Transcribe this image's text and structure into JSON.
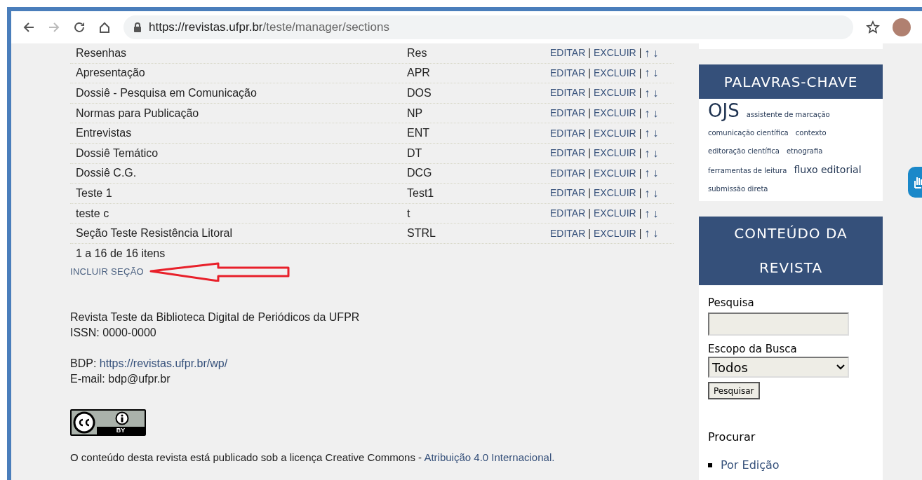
{
  "browser": {
    "url_host": "https://revistas.ufpr.br",
    "url_path": "/teste/manager/sections"
  },
  "table": {
    "rows": [
      {
        "title": "Resenhas",
        "abbrev": "Res",
        "actions": [
          {
            "kind": "link",
            "label": "EDITAR"
          },
          {
            "kind": "separator",
            "label": "|"
          },
          {
            "kind": "link",
            "label": "EXCLUIR"
          },
          {
            "kind": "separator",
            "label": "|"
          },
          {
            "kind": "arrow",
            "label": "↑"
          },
          {
            "kind": "arrow",
            "label": "↓"
          }
        ]
      },
      {
        "title": "Apresentação",
        "abbrev": "APR",
        "actions": [
          {
            "kind": "link",
            "label": "EDITAR"
          },
          {
            "kind": "separator",
            "label": "|"
          },
          {
            "kind": "link",
            "label": "EXCLUIR"
          },
          {
            "kind": "separator",
            "label": "|"
          },
          {
            "kind": "arrow",
            "label": "↑"
          },
          {
            "kind": "arrow",
            "label": "↓"
          }
        ]
      },
      {
        "title": "Dossiê - Pesquisa em Comunicação",
        "abbrev": "DOS",
        "actions": [
          {
            "kind": "link",
            "label": "EDITAR"
          },
          {
            "kind": "separator",
            "label": "|"
          },
          {
            "kind": "link",
            "label": "EXCLUIR"
          },
          {
            "kind": "separator",
            "label": "|"
          },
          {
            "kind": "arrow",
            "label": "↑"
          },
          {
            "kind": "arrow",
            "label": "↓"
          }
        ]
      },
      {
        "title": "Normas para Publicação",
        "abbrev": "NP",
        "actions": [
          {
            "kind": "link",
            "label": "EDITAR"
          },
          {
            "kind": "separator",
            "label": "|"
          },
          {
            "kind": "link",
            "label": "EXCLUIR"
          },
          {
            "kind": "separator",
            "label": "|"
          },
          {
            "kind": "arrow",
            "label": "↑"
          },
          {
            "kind": "arrow",
            "label": "↓"
          }
        ]
      },
      {
        "title": "Entrevistas",
        "abbrev": "ENT",
        "actions": [
          {
            "kind": "link",
            "label": "EDITAR"
          },
          {
            "kind": "separator",
            "label": "|"
          },
          {
            "kind": "link",
            "label": "EXCLUIR"
          },
          {
            "kind": "separator",
            "label": "|"
          },
          {
            "kind": "arrow",
            "label": "↑"
          },
          {
            "kind": "arrow",
            "label": "↓"
          }
        ]
      },
      {
        "title": "Dossiê Temático",
        "abbrev": "DT",
        "actions": [
          {
            "kind": "link",
            "label": "EDITAR"
          },
          {
            "kind": "separator",
            "label": "|"
          },
          {
            "kind": "link",
            "label": "EXCLUIR"
          },
          {
            "kind": "separator",
            "label": "|"
          },
          {
            "kind": "arrow",
            "label": "↑"
          },
          {
            "kind": "arrow",
            "label": "↓"
          }
        ]
      },
      {
        "title": "Dossiê C.G.",
        "abbrev": "DCG",
        "actions": [
          {
            "kind": "link",
            "label": "EDITAR"
          },
          {
            "kind": "separator",
            "label": "|"
          },
          {
            "kind": "link",
            "label": "EXCLUIR"
          },
          {
            "kind": "separator",
            "label": "|"
          },
          {
            "kind": "arrow",
            "label": "↑"
          },
          {
            "kind": "arrow",
            "label": "↓"
          }
        ]
      },
      {
        "title": "Teste 1",
        "abbrev": "Test1",
        "actions": [
          {
            "kind": "link",
            "label": "EDITAR"
          },
          {
            "kind": "separator",
            "label": "|"
          },
          {
            "kind": "link",
            "label": "EXCLUIR"
          },
          {
            "kind": "separator",
            "label": "|"
          },
          {
            "kind": "arrow",
            "label": "↑"
          },
          {
            "kind": "arrow",
            "label": "↓"
          }
        ]
      },
      {
        "title": "teste c",
        "abbrev": "t",
        "actions": [
          {
            "kind": "link",
            "label": "EDITAR"
          },
          {
            "kind": "separator",
            "label": "|"
          },
          {
            "kind": "link",
            "label": "EXCLUIR"
          },
          {
            "kind": "separator",
            "label": "|"
          },
          {
            "kind": "arrow",
            "label": "↑"
          },
          {
            "kind": "arrow",
            "label": "↓"
          }
        ]
      },
      {
        "title": "Seção Teste Resistência Litoral",
        "abbrev": "STRL",
        "actions": [
          {
            "kind": "link",
            "label": "EDITAR"
          },
          {
            "kind": "separator",
            "label": "|"
          },
          {
            "kind": "link",
            "label": "EXCLUIR"
          },
          {
            "kind": "separator",
            "label": "|"
          },
          {
            "kind": "arrow",
            "label": "↑"
          },
          {
            "kind": "arrow",
            "label": "↓"
          }
        ]
      }
    ],
    "pagination": "1 a 16 de 16 itens"
  },
  "add_link": "INCLUIR SEÇÃO",
  "footer": {
    "lines": [
      "Revista Teste da Biblioteca Digital de Periódicos da UFPR",
      "ISSN: 0000-0000"
    ],
    "bdp_label": "BDP:",
    "bdp_link": "https://revistas.ufpr.br/wp/",
    "email": "E-mail: bdp@ufpr.br",
    "license_text": "O conteúdo desta revista está publicado sob a licença Creative Commons -",
    "license_link": "Atribuição 4.0 Internacional.",
    "badge_label": "BY"
  },
  "sidebar": {
    "keywords_title": "PALAVRAS-CHAVE",
    "keywords": [
      {
        "label": "OJS",
        "kind": "large"
      },
      {
        "label": "assistente de marcação",
        "kind": "small"
      },
      {
        "label": "comunicação científica",
        "kind": "small"
      },
      {
        "label": "contexto",
        "kind": "small"
      },
      {
        "label": "editoração científica",
        "kind": "small"
      },
      {
        "label": "etnografia",
        "kind": "small"
      },
      {
        "label": "ferramentas de leitura",
        "kind": "small"
      },
      {
        "label": "fluxo editorial",
        "kind": "medium"
      },
      {
        "label": "submissão direta",
        "kind": "small"
      }
    ],
    "content_title": "CONTEÚDO DA REVISTA",
    "search_label": "Pesquisa",
    "scope_label": "Escopo da Busca",
    "scope_value": "Todos",
    "search_button": "Pesquisar",
    "browse_title": "Procurar",
    "browse_items": [
      "Por Edição"
    ]
  }
}
